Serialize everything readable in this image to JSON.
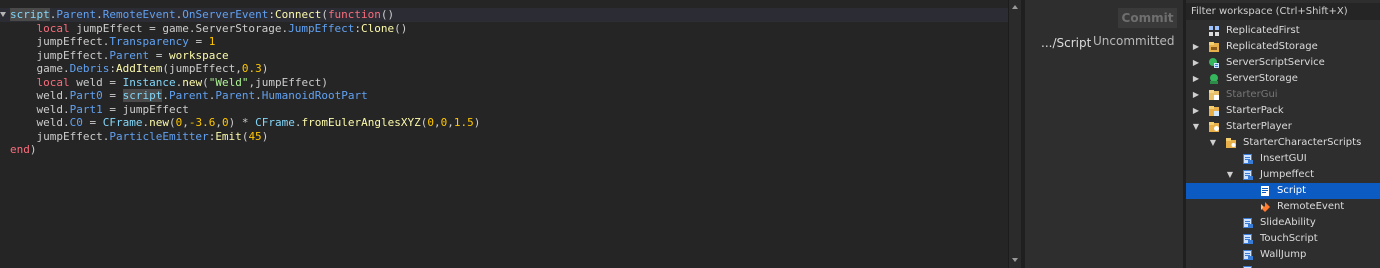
{
  "colors": {
    "keyword": "#f86d7c",
    "builtin": "#84d6f7",
    "property": "#61a1f1",
    "method": "#fdfbac",
    "number": "#ffc600",
    "string": "#adf195",
    "text": "#cccccc",
    "selection": "#0b5bc3"
  },
  "editor": {
    "lines": [
      [
        {
          "t": "script",
          "c": "builtin",
          "hl": true
        },
        {
          "t": ".",
          "c": "text"
        },
        {
          "t": "Parent",
          "c": "property"
        },
        {
          "t": ".",
          "c": "text"
        },
        {
          "t": "RemoteEvent",
          "c": "property"
        },
        {
          "t": ".",
          "c": "text"
        },
        {
          "t": "OnServerEvent",
          "c": "property"
        },
        {
          "t": ":",
          "c": "text"
        },
        {
          "t": "Connect",
          "c": "method"
        },
        {
          "t": "(",
          "c": "text"
        },
        {
          "t": "function",
          "c": "keyword"
        },
        {
          "t": "()",
          "c": "text"
        }
      ],
      [
        {
          "t": "    ",
          "c": "text"
        },
        {
          "t": "local",
          "c": "keyword"
        },
        {
          "t": " jumpEffect = game.ServerStorage.",
          "c": "text"
        },
        {
          "t": "JumpEffect",
          "c": "property"
        },
        {
          "t": ":",
          "c": "text"
        },
        {
          "t": "Clone",
          "c": "method"
        },
        {
          "t": "()",
          "c": "text"
        }
      ],
      [
        {
          "t": "    jumpEffect.",
          "c": "text"
        },
        {
          "t": "Transparency",
          "c": "property"
        },
        {
          "t": " = ",
          "c": "text"
        },
        {
          "t": "1",
          "c": "number"
        }
      ],
      [
        {
          "t": "    jumpEffect.",
          "c": "text"
        },
        {
          "t": "Parent",
          "c": "property"
        },
        {
          "t": " = ",
          "c": "text"
        },
        {
          "t": "workspace",
          "c": "method"
        }
      ],
      [
        {
          "t": "    game.",
          "c": "text"
        },
        {
          "t": "Debris",
          "c": "property"
        },
        {
          "t": ":",
          "c": "text"
        },
        {
          "t": "AddItem",
          "c": "method"
        },
        {
          "t": "(jumpEffect,",
          "c": "text"
        },
        {
          "t": "0.3",
          "c": "number"
        },
        {
          "t": ")",
          "c": "text"
        }
      ],
      [
        {
          "t": "    ",
          "c": "text"
        },
        {
          "t": "local",
          "c": "keyword"
        },
        {
          "t": " weld = ",
          "c": "text"
        },
        {
          "t": "Instance",
          "c": "builtin"
        },
        {
          "t": ".",
          "c": "text"
        },
        {
          "t": "new",
          "c": "method"
        },
        {
          "t": "(",
          "c": "text"
        },
        {
          "t": "\"Weld\"",
          "c": "string"
        },
        {
          "t": ",jumpEffect)",
          "c": "text"
        }
      ],
      [
        {
          "t": "    weld.",
          "c": "text"
        },
        {
          "t": "Part0",
          "c": "property"
        },
        {
          "t": " = ",
          "c": "text"
        },
        {
          "t": "script",
          "c": "builtin",
          "hl": true
        },
        {
          "t": ".",
          "c": "text"
        },
        {
          "t": "Parent",
          "c": "property"
        },
        {
          "t": ".",
          "c": "text"
        },
        {
          "t": "Parent",
          "c": "property"
        },
        {
          "t": ".",
          "c": "text"
        },
        {
          "t": "HumanoidRootPart",
          "c": "property"
        }
      ],
      [
        {
          "t": "    weld.",
          "c": "text"
        },
        {
          "t": "Part1",
          "c": "property"
        },
        {
          "t": " = jumpEffect",
          "c": "text"
        }
      ],
      [
        {
          "t": "    weld.",
          "c": "text"
        },
        {
          "t": "C0",
          "c": "property"
        },
        {
          "t": " = ",
          "c": "text"
        },
        {
          "t": "CFrame",
          "c": "builtin"
        },
        {
          "t": ".",
          "c": "text"
        },
        {
          "t": "new",
          "c": "method"
        },
        {
          "t": "(",
          "c": "text"
        },
        {
          "t": "0",
          "c": "number"
        },
        {
          "t": ",",
          "c": "text"
        },
        {
          "t": "-3.6",
          "c": "number"
        },
        {
          "t": ",",
          "c": "text"
        },
        {
          "t": "0",
          "c": "number"
        },
        {
          "t": ") * ",
          "c": "text"
        },
        {
          "t": "CFrame",
          "c": "builtin"
        },
        {
          "t": ".",
          "c": "text"
        },
        {
          "t": "fromEulerAnglesXYZ",
          "c": "method"
        },
        {
          "t": "(",
          "c": "text"
        },
        {
          "t": "0",
          "c": "number"
        },
        {
          "t": ",",
          "c": "text"
        },
        {
          "t": "0",
          "c": "number"
        },
        {
          "t": ",",
          "c": "text"
        },
        {
          "t": "1.5",
          "c": "number"
        },
        {
          "t": ")",
          "c": "text"
        }
      ],
      [
        {
          "t": "    jumpEffect.",
          "c": "text"
        },
        {
          "t": "ParticleEmitter",
          "c": "property"
        },
        {
          "t": ":",
          "c": "text"
        },
        {
          "t": "Emit",
          "c": "method"
        },
        {
          "t": "(",
          "c": "text"
        },
        {
          "t": "45",
          "c": "number"
        },
        {
          "t": ")",
          "c": "text"
        }
      ],
      [
        {
          "t": "end",
          "c": "keyword"
        },
        {
          "t": ")",
          "c": "text"
        }
      ]
    ]
  },
  "commit_panel": {
    "commit_label": "Commit",
    "script_path": ".../Script",
    "status": "Uncommitted"
  },
  "explorer": {
    "filter_placeholder": "Filter workspace (Ctrl+Shift+X)",
    "items": [
      {
        "label": "ReplicatedFirst",
        "depth": 0,
        "arrow": "",
        "icon": "replicated-first-icon",
        "dim": false,
        "selected": false
      },
      {
        "label": "ReplicatedStorage",
        "depth": 0,
        "arrow": "right",
        "icon": "replicated-storage-icon",
        "dim": false,
        "selected": false
      },
      {
        "label": "ServerScriptService",
        "depth": 0,
        "arrow": "right",
        "icon": "server-script-service-icon",
        "dim": false,
        "selected": false
      },
      {
        "label": "ServerStorage",
        "depth": 0,
        "arrow": "right",
        "icon": "server-storage-icon",
        "dim": false,
        "selected": false
      },
      {
        "label": "StarterGui",
        "depth": 0,
        "arrow": "right",
        "icon": "starter-gui-icon",
        "dim": true,
        "selected": false
      },
      {
        "label": "StarterPack",
        "depth": 0,
        "arrow": "right",
        "icon": "starter-pack-icon",
        "dim": false,
        "selected": false
      },
      {
        "label": "StarterPlayer",
        "depth": 0,
        "arrow": "down",
        "icon": "starter-player-icon",
        "dim": false,
        "selected": false
      },
      {
        "label": "StarterCharacterScripts",
        "depth": 1,
        "arrow": "down",
        "icon": "folder-icon",
        "dim": false,
        "selected": false
      },
      {
        "label": "InsertGUI",
        "depth": 2,
        "arrow": "",
        "icon": "local-script-icon",
        "dim": false,
        "selected": false
      },
      {
        "label": "Jumpeffect",
        "depth": 2,
        "arrow": "down",
        "icon": "local-script-icon",
        "dim": false,
        "selected": false
      },
      {
        "label": "Script",
        "depth": 3,
        "arrow": "",
        "icon": "script-icon",
        "dim": false,
        "selected": true
      },
      {
        "label": "RemoteEvent",
        "depth": 3,
        "arrow": "",
        "icon": "remote-event-icon",
        "dim": false,
        "selected": false
      },
      {
        "label": "SlideAbility",
        "depth": 2,
        "arrow": "",
        "icon": "local-script-icon",
        "dim": false,
        "selected": false
      },
      {
        "label": "TouchScript",
        "depth": 2,
        "arrow": "",
        "icon": "local-script-icon",
        "dim": false,
        "selected": false
      },
      {
        "label": "WallJump",
        "depth": 2,
        "arrow": "",
        "icon": "local-script-icon",
        "dim": false,
        "selected": false
      },
      {
        "label": "",
        "depth": 2,
        "arrow": "",
        "icon": "local-script-icon",
        "dim": false,
        "selected": false
      }
    ]
  }
}
